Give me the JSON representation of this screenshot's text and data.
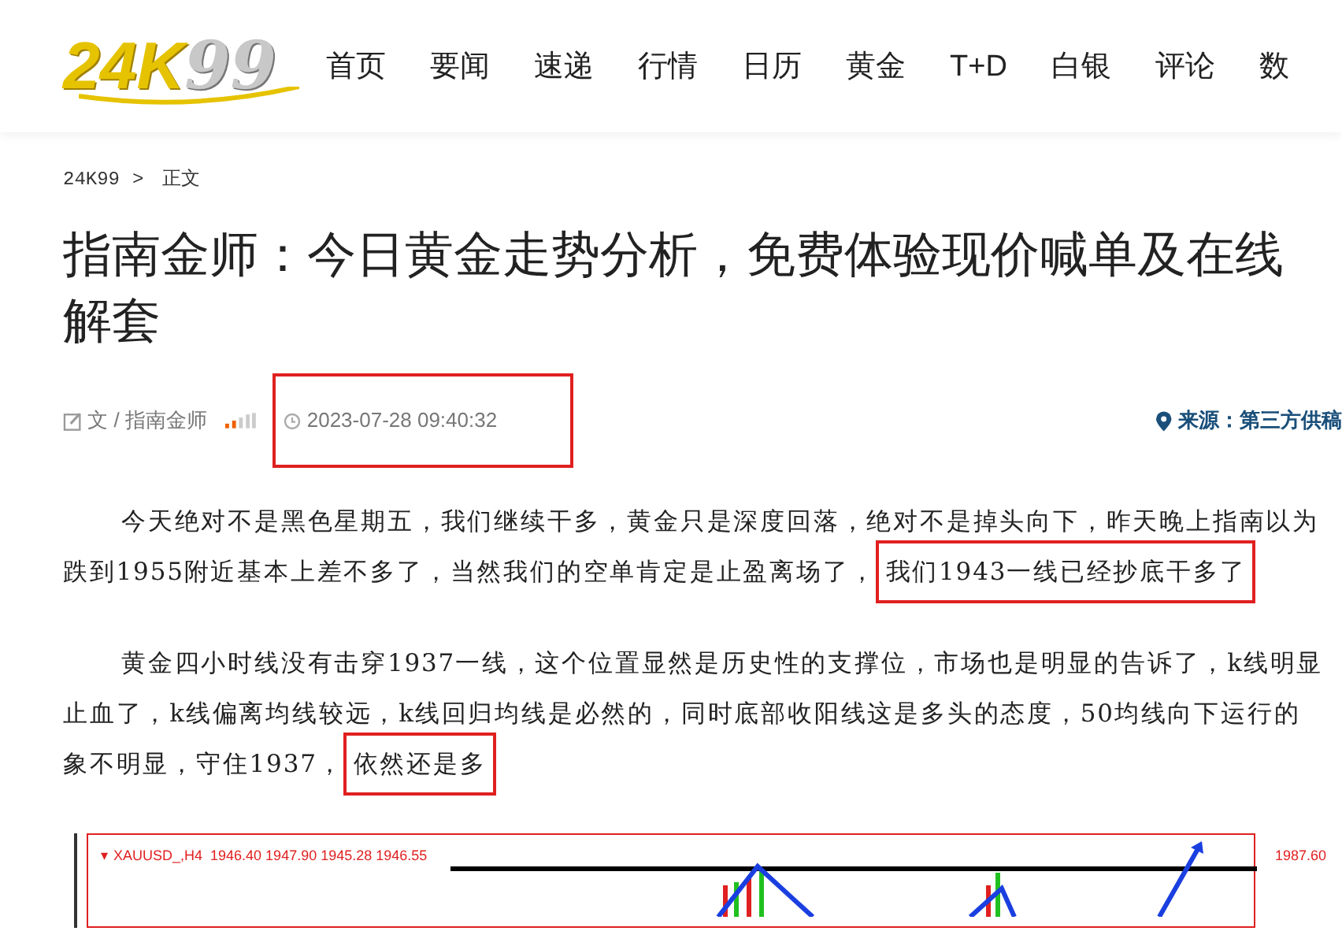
{
  "logo": {
    "main": "24K",
    "accent": "99"
  },
  "nav": [
    "首页",
    "要闻",
    "速递",
    "行情",
    "日历",
    "黄金",
    "T+D",
    "白银",
    "评论",
    "数"
  ],
  "breadcrumb": {
    "home": "24K99",
    "separator": ">",
    "current": "正文"
  },
  "title": "指南金师：今日黄金走势分析，免费体验现价喊单及在线解套",
  "meta": {
    "author": "文 / 指南金师",
    "date": "2023-07-28 09:40:32",
    "source": "来源：第三方供稿"
  },
  "paragraphs": [
    {
      "lines": [
        [
          {
            "text": "今天绝对不是黑色星期五，我们继续干多，黄金只是深度回落，绝对不是掉头向下，昨天晚上指南以为",
            "highlighted": false
          }
        ],
        [
          {
            "text": "跌到1955附近基本上差不多了，当然我们的空单肯定是止盈离场了，",
            "highlighted": false
          },
          {
            "text": "我们1943一线已经抄底干多了",
            "highlighted": true
          }
        ]
      ]
    },
    {
      "lines": [
        [
          {
            "text": "黄金四小时线没有击穿1937一线，这个位置显然是历史性的支撑位，市场也是明显的告诉了，k线明显",
            "highlighted": false
          }
        ],
        [
          {
            "text": "止血了，k线偏离均线较远，k线回归均线是必然的，同时底部收阳线这是多头的态度，50均线向下运行的",
            "highlighted": false
          }
        ],
        [
          {
            "text": "象不明显，守住1937，",
            "highlighted": false
          },
          {
            "text": "依然还是多",
            "highlighted": true
          }
        ]
      ]
    }
  ],
  "chart": {
    "marker": "▾",
    "header": "XAUUSD_,H4  1946.40 1947.90 1945.28 1946.55",
    "price_label": "1987.60"
  }
}
